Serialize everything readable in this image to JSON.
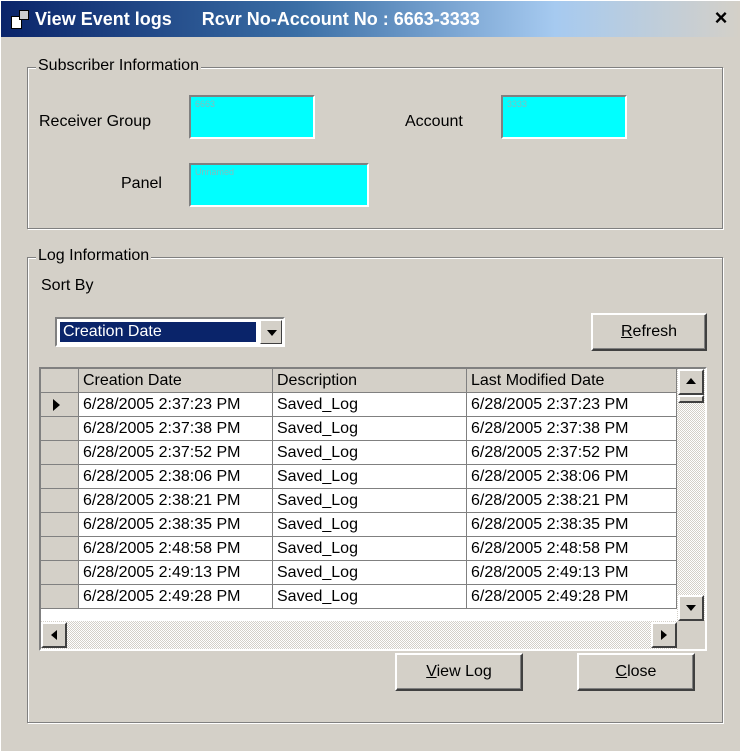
{
  "window": {
    "title": "View Event logs",
    "subtitle": "Rcvr No-Account No : 6663-3333",
    "close_label": "×"
  },
  "subscriber": {
    "legend": "Subscriber Information",
    "receiver_group_label": "Receiver Group",
    "receiver_group_value": "6663",
    "account_label": "Account",
    "account_value": "3333",
    "panel_label": "Panel",
    "panel_value": "Unnamed"
  },
  "log": {
    "legend": "Log Information",
    "sort_by_label": "Sort By",
    "sort_selected": "Creation Date",
    "refresh_label_pre": "",
    "refresh_label_mnemonic": "R",
    "refresh_label_post": "efresh"
  },
  "table": {
    "columns": [
      "Creation Date",
      "Description",
      "Last Modified Date"
    ],
    "rows": [
      [
        "6/28/2005 2:37:23 PM",
        "Saved_Log",
        "6/28/2005 2:37:23 PM"
      ],
      [
        "6/28/2005 2:37:38 PM",
        "Saved_Log",
        "6/28/2005 2:37:38 PM"
      ],
      [
        "6/28/2005 2:37:52 PM",
        "Saved_Log",
        "6/28/2005 2:37:52 PM"
      ],
      [
        "6/28/2005 2:38:06 PM",
        "Saved_Log",
        "6/28/2005 2:38:06 PM"
      ],
      [
        "6/28/2005 2:38:21 PM",
        "Saved_Log",
        "6/28/2005 2:38:21 PM"
      ],
      [
        "6/28/2005 2:38:35 PM",
        "Saved_Log",
        "6/28/2005 2:38:35 PM"
      ],
      [
        "6/28/2005 2:48:58 PM",
        "Saved_Log",
        "6/28/2005 2:48:58 PM"
      ],
      [
        "6/28/2005 2:49:13 PM",
        "Saved_Log",
        "6/28/2005 2:49:13 PM"
      ],
      [
        "6/28/2005 2:49:28 PM",
        "Saved_Log",
        "6/28/2005 2:49:28 PM"
      ]
    ],
    "selected_row": 0
  },
  "buttons": {
    "view_log_mnemonic": "V",
    "view_log_rest": "iew Log",
    "close_mnemonic": "C",
    "close_rest": "lose"
  },
  "icons": {
    "window_icon": "app-icon",
    "close": "close-icon",
    "combo_arrow": "chevron-down-icon",
    "row_pointer": "row-pointer-icon"
  },
  "colors": {
    "titlebar": "#0a246a",
    "field_bg": "#00ffff",
    "dialog_bg": "#d4d0c8",
    "selection": "#0a246a"
  }
}
